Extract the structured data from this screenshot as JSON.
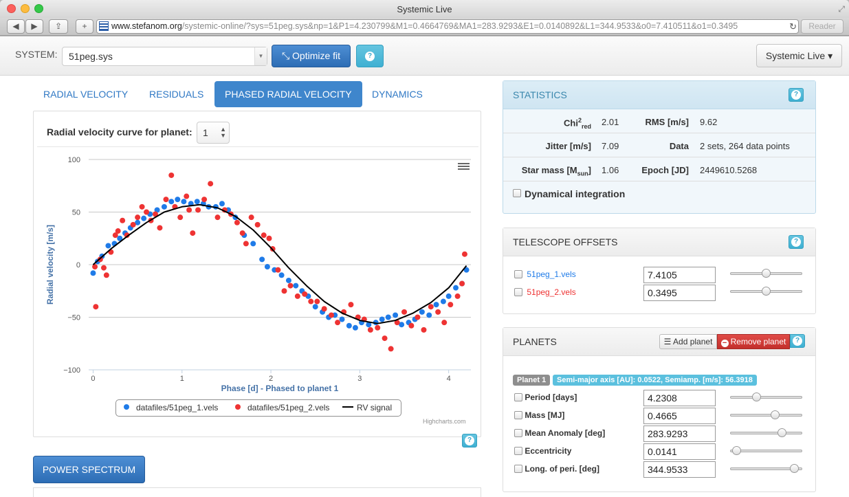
{
  "window": {
    "title": "Systemic Live"
  },
  "browser": {
    "url_host": "www.stefanom.org",
    "url_path": "/systemic-online/?sys=51peg.sys&np=1&P1=4.230799&M1=0.4664769&MA1=283.9293&E1=0.0140892&L1=344.9533&o0=7.410511&o1=0.3495",
    "reader_label": "Reader",
    "back_label": "◀",
    "forward_label": "▶",
    "share_label": "⇪",
    "new_tab_label": "+"
  },
  "navbar": {
    "system_label": "SYSTEM:",
    "system_value": "51peg.sys",
    "optimize_label": "Optimize fit",
    "menu_label": "Systemic Live ▾"
  },
  "tabs": [
    {
      "label": "RADIAL VELOCITY",
      "active": false
    },
    {
      "label": "RESIDUALS",
      "active": false
    },
    {
      "label": "PHASED RADIAL VELOCITY",
      "active": true
    },
    {
      "label": "DYNAMICS",
      "active": false
    }
  ],
  "chart_panel": {
    "heading": "Radial velocity curve for planet:",
    "planet_value": "1",
    "credits": "Highcharts.com",
    "power_spectrum_label": "POWER SPECTRUM"
  },
  "chart_data": {
    "type": "scatter",
    "xlabel": "Phase [d] - Phased to planet 1",
    "ylabel": "Radial velocity [m/s]",
    "xlim": [
      -0.05,
      4.25
    ],
    "ylim": [
      -100,
      100
    ],
    "xticks": [
      0,
      1,
      2,
      3,
      4
    ],
    "yticks": [
      100,
      50,
      0,
      -50,
      -100
    ],
    "ytick_labels": [
      "100",
      "50",
      "0",
      "−50",
      "−100"
    ],
    "grid": true,
    "legend_position": "bottom",
    "series": [
      {
        "name": "datafiles/51peg_1.vels",
        "type": "scatter",
        "color": "#1f7be8",
        "x": [
          0.0,
          0.05,
          0.1,
          0.17,
          0.24,
          0.3,
          0.36,
          0.42,
          0.5,
          0.57,
          0.64,
          0.72,
          0.8,
          0.88,
          0.95,
          1.02,
          1.1,
          1.17,
          1.24,
          1.3,
          1.38,
          1.45,
          1.52,
          1.6,
          1.7,
          1.8,
          1.9,
          1.96,
          2.04,
          2.12,
          2.2,
          2.28,
          2.35,
          2.42,
          2.5,
          2.58,
          2.65,
          2.72,
          2.8,
          2.88,
          2.95,
          3.02,
          3.1,
          3.18,
          3.25,
          3.32,
          3.4,
          3.47,
          3.55,
          3.62,
          3.7,
          3.78,
          3.86,
          3.94,
          4.0,
          4.08,
          4.15,
          4.2
        ],
        "y": [
          -8,
          3,
          8,
          18,
          20,
          25,
          30,
          35,
          40,
          44,
          48,
          52,
          55,
          60,
          62,
          60,
          58,
          60,
          58,
          55,
          55,
          58,
          52,
          45,
          28,
          20,
          5,
          -2,
          -5,
          -10,
          -15,
          -20,
          -25,
          -30,
          -40,
          -45,
          -50,
          -48,
          -52,
          -58,
          -60,
          -55,
          -57,
          -55,
          -52,
          -50,
          -48,
          -57,
          -55,
          -52,
          -45,
          -48,
          -38,
          -35,
          -30,
          -22,
          -18,
          -5
        ]
      },
      {
        "name": "datafiles/51peg_2.vels",
        "type": "scatter",
        "color": "#ee3333",
        "x": [
          0.02,
          0.03,
          0.08,
          0.12,
          0.15,
          0.2,
          0.25,
          0.28,
          0.33,
          0.38,
          0.45,
          0.5,
          0.55,
          0.6,
          0.65,
          0.7,
          0.75,
          0.82,
          0.88,
          0.92,
          0.98,
          1.05,
          1.08,
          1.12,
          1.18,
          1.25,
          1.32,
          1.4,
          1.48,
          1.55,
          1.62,
          1.68,
          1.72,
          1.78,
          1.85,
          1.92,
          1.98,
          2.02,
          2.08,
          2.15,
          2.22,
          2.3,
          2.38,
          2.45,
          2.52,
          2.6,
          2.68,
          2.75,
          2.82,
          2.9,
          2.98,
          3.05,
          3.12,
          3.2,
          3.28,
          3.35,
          3.42,
          3.5,
          3.58,
          3.65,
          3.72,
          3.8,
          3.88,
          3.95,
          4.02,
          4.1,
          4.15,
          4.18
        ],
        "y": [
          -2,
          -40,
          5,
          -3,
          -10,
          12,
          28,
          32,
          42,
          28,
          38,
          45,
          55,
          50,
          42,
          48,
          35,
          62,
          85,
          55,
          45,
          65,
          52,
          30,
          52,
          62,
          77,
          45,
          52,
          48,
          40,
          30,
          20,
          45,
          38,
          28,
          25,
          15,
          -5,
          -25,
          -20,
          -30,
          -28,
          -35,
          -35,
          -42,
          -48,
          -55,
          -45,
          -38,
          -50,
          -52,
          -62,
          -60,
          -70,
          -80,
          -55,
          -45,
          -58,
          -50,
          -62,
          -40,
          -45,
          -55,
          -38,
          -30,
          -18,
          10
        ]
      },
      {
        "name": "RV signal",
        "type": "line",
        "color": "#000000",
        "x": [
          0.0,
          0.2,
          0.4,
          0.6,
          0.8,
          1.0,
          1.2,
          1.4,
          1.6,
          1.8,
          2.0,
          2.2,
          2.4,
          2.6,
          2.8,
          3.0,
          3.2,
          3.4,
          3.6,
          3.8,
          4.0,
          4.2
        ],
        "y": [
          0,
          15,
          28,
          40,
          50,
          55,
          57,
          54,
          46,
          33,
          16,
          -3,
          -20,
          -35,
          -46,
          -53,
          -56,
          -53,
          -46,
          -36,
          -22,
          -1
        ]
      }
    ]
  },
  "statistics": {
    "title": "STATISTICS",
    "chi_label": "Chi",
    "chi_sup": "2",
    "chi_sub": "red",
    "chi_value": "2.01",
    "rms_label": "RMS [m/s]",
    "rms_value": "9.62",
    "jitter_label": "Jitter [m/s]",
    "jitter_value": "7.09",
    "data_label": "Data",
    "data_value": "2 sets, 264 data points",
    "mass_label": "Star mass [M",
    "mass_sub": "sun",
    "mass_close": "]",
    "mass_value": "1.06",
    "epoch_label": "Epoch [JD]",
    "epoch_value": "2449610.5268",
    "dyn_label": "Dynamical integration"
  },
  "offsets": {
    "title": "TELESCOPE OFFSETS",
    "rows": [
      {
        "label": "51peg_1.vels",
        "value": "7.4105",
        "color": "#1f7be8",
        "slider": 0.5
      },
      {
        "label": "51peg_2.vels",
        "value": "0.3495",
        "color": "#ee3333",
        "slider": 0.5
      }
    ]
  },
  "planets": {
    "title": "PLANETS",
    "add_label": "Add planet",
    "remove_label": "Remove planet",
    "badge": "Planet 1",
    "info": "Semi-major axis [AU]: 0.0522, Semiamp. [m/s]: 56.3918",
    "rows": [
      {
        "label": "Period [days]",
        "value": "4.2308",
        "slider": 0.35
      },
      {
        "label": "Mass [MJ]",
        "value": "0.4665",
        "slider": 0.64
      },
      {
        "label": "Mean Anomaly [deg]",
        "value": "283.9293",
        "slider": 0.75
      },
      {
        "label": "Eccentricity",
        "value": "0.0141",
        "slider": 0.03
      },
      {
        "label": "Long. of peri. [deg]",
        "value": "344.9533",
        "slider": 0.95
      }
    ]
  }
}
